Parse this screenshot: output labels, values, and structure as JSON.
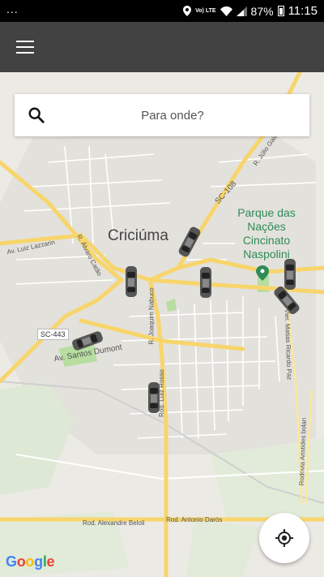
{
  "status_bar": {
    "left": "...",
    "volte": "Vo) LTE",
    "battery": "87%",
    "time": "11:15"
  },
  "search": {
    "placeholder": "Para onde?"
  },
  "map_labels": {
    "city": "Criciúma",
    "park": "Parque das Nações Cincinato Naspolini",
    "sc108": "SC-108",
    "sc443": "SC-443",
    "r_julio": "R. Júlio Gaia",
    "av_luiz": "Av. Luiz Lazzarin",
    "r_alvaro": "R. Álvaro Catão",
    "r_joaquim": "R. Joaquim Nabuco",
    "av_santos": "Av. Santos Dumont",
    "rod_luiz_rosso": "Rod. Luiz Rosso",
    "r_matias": "Vier. Matias Ricardo Paz",
    "rod_aristides": "Rodovia Aristides bolan",
    "rod_alexandre": "Rod. Alexandre Beloli",
    "rod_antonio": "Rod. Antonio Darós"
  },
  "attribution": {
    "google": [
      "G",
      "o",
      "o",
      "g",
      "l",
      "e"
    ]
  },
  "colors": {
    "app_bar": "#424242",
    "map_background": "#eceae4",
    "major_road": "#f8d56b",
    "park": "#2e8b57"
  }
}
